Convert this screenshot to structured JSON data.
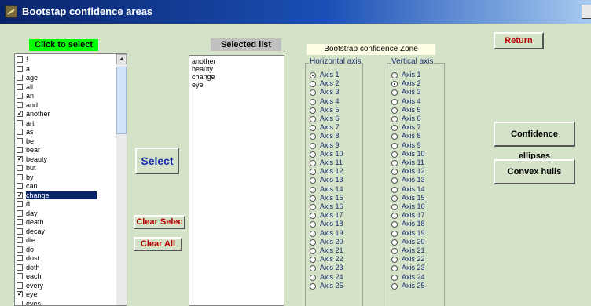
{
  "window": {
    "title": "Bootstap confidence areas"
  },
  "labels": {
    "click_to_select": "Click to select",
    "selected_list": "Selected list",
    "bootstrap_zone": "Bootstrap confidence Zone",
    "horizontal_axis": "Horizontal axis",
    "vertical_axis": "Vertical axis"
  },
  "word_list": [
    {
      "word": "!",
      "checked": false
    },
    {
      "word": "a",
      "checked": false
    },
    {
      "word": "age",
      "checked": false
    },
    {
      "word": "all",
      "checked": false
    },
    {
      "word": "an",
      "checked": false
    },
    {
      "word": "and",
      "checked": false
    },
    {
      "word": "another",
      "checked": true
    },
    {
      "word": "art",
      "checked": false
    },
    {
      "word": "as",
      "checked": false
    },
    {
      "word": "be",
      "checked": false
    },
    {
      "word": "bear",
      "checked": false
    },
    {
      "word": "beauty",
      "checked": true
    },
    {
      "word": "but",
      "checked": false
    },
    {
      "word": "by",
      "checked": false
    },
    {
      "word": "can",
      "checked": false
    },
    {
      "word": "change",
      "checked": true,
      "highlighted": true
    },
    {
      "word": "d",
      "checked": false
    },
    {
      "word": "day",
      "checked": false
    },
    {
      "word": "death",
      "checked": false
    },
    {
      "word": "decay",
      "checked": false
    },
    {
      "word": "die",
      "checked": false
    },
    {
      "word": "do",
      "checked": false
    },
    {
      "word": "dost",
      "checked": false
    },
    {
      "word": "doth",
      "checked": false
    },
    {
      "word": "each",
      "checked": false
    },
    {
      "word": "every",
      "checked": false
    },
    {
      "word": "eye",
      "checked": true
    },
    {
      "word": "eyes",
      "checked": false
    }
  ],
  "selected_list": [
    "another",
    "beauty",
    "change",
    "eye"
  ],
  "buttons": {
    "select": "Select",
    "clear_selection": "Clear Selec",
    "clear_all": "Clear All",
    "return": "Return",
    "confidence_ellipses": "Confidence ellipses",
    "convex_hulls": "Convex hulls"
  },
  "horizontal_axes": [
    "Axis 1",
    "Axis 2",
    "Axis 3",
    "Axis 4",
    "Axis 5",
    "Axis 6",
    "Axis 7",
    "Axis 8",
    "Axis 9",
    "Axis 10",
    "Axis 11",
    "Axis 12",
    "Axis 13",
    "Axis 14",
    "Axis 15",
    "Axis 16",
    "Axis 17",
    "Axis 18",
    "Axis 19",
    "Axis 20",
    "Axis 21",
    "Axis 22",
    "Axis 23",
    "Axis 24",
    "Axis 25"
  ],
  "horizontal_selected": "Axis 1",
  "vertical_axes": [
    "Axis 1",
    "Axis 2",
    "Axis 3",
    "Axis 4",
    "Axis 5",
    "Axis 6",
    "Axis 7",
    "Axis 8",
    "Axis 9",
    "Axis 10",
    "Axis 11",
    "Axis 12",
    "Axis 13",
    "Axis 14",
    "Axis 15",
    "Axis 16",
    "Axis 17",
    "Axis 18",
    "Axis 19",
    "Axis 20",
    "Axis 21",
    "Axis 22",
    "Axis 23",
    "Axis 24",
    "Axis 25"
  ],
  "vertical_selected": "Axis 2"
}
